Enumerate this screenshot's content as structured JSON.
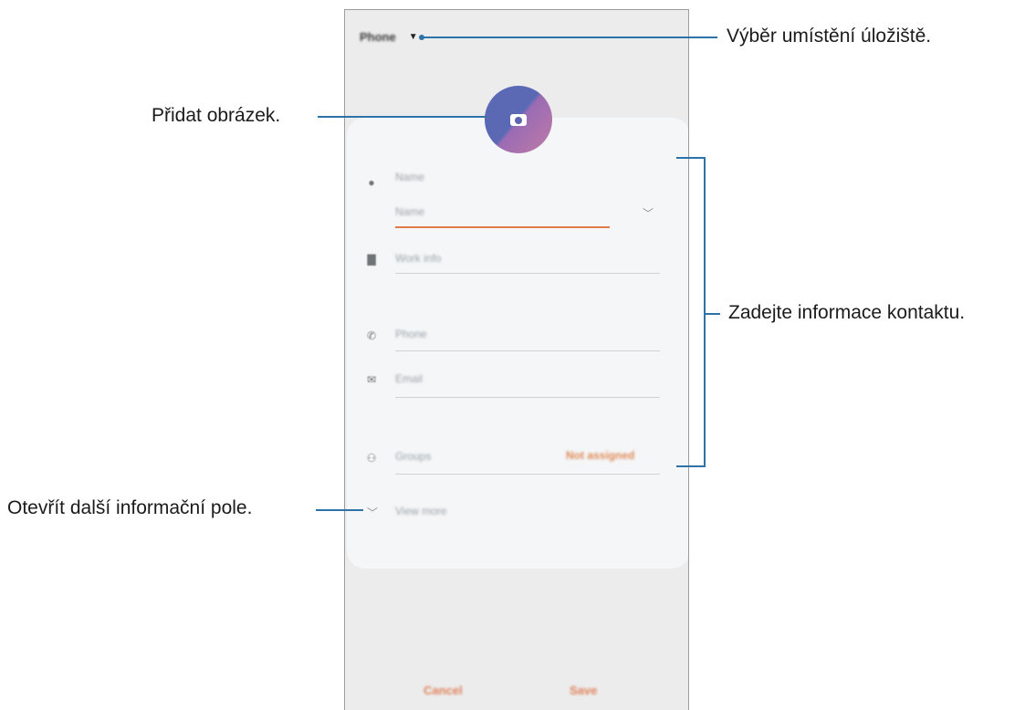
{
  "screen": {
    "storage": {
      "label": "Phone"
    },
    "fields": {
      "name_section": "Name",
      "name_input_placeholder": "Name",
      "work_info": "Work info",
      "phone": "Phone",
      "email": "Email",
      "groups": "Groups",
      "groups_value": "Not assigned",
      "view_more": "View more"
    },
    "buttons": {
      "cancel": "Cancel",
      "save": "Save"
    }
  },
  "annotations": {
    "storage": "Výběr umístění úložiště.",
    "add_image": "Přidat obrázek.",
    "contact_info": "Zadejte informace kontaktu.",
    "more_fields": "Otevřít další informační pole."
  },
  "colors": {
    "accent": "#e07a46",
    "callout_line": "#2e73a8",
    "avatar_start": "#5b69b4",
    "avatar_end": "#c07aa6"
  }
}
